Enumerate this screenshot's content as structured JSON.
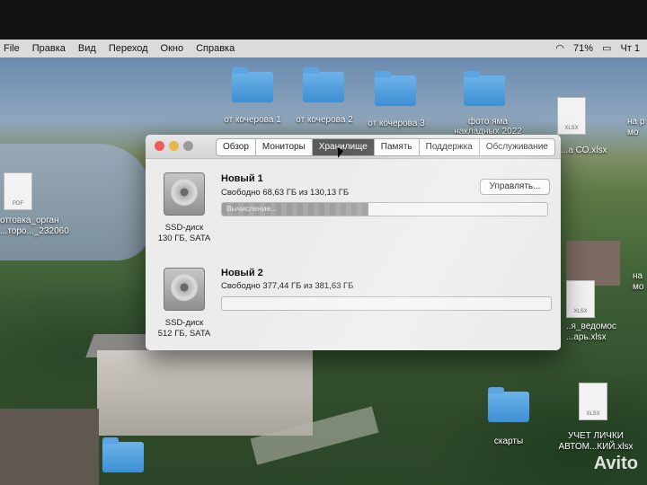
{
  "menubar": {
    "items": [
      "File",
      "Правка",
      "Вид",
      "Переход",
      "Окно",
      "Справка"
    ],
    "battery": "71%",
    "clock": "Чт 1"
  },
  "desktop": {
    "folders": [
      {
        "label": "от кочерова 1"
      },
      {
        "label": "от кочерова 2"
      },
      {
        "label": "от кочерова 3"
      },
      {
        "label": "фото яма\nнакладных 2022"
      },
      {
        "label": "скарты"
      }
    ],
    "files": [
      {
        "label": "отговка_орган\n...торо..._232060",
        "type": "PDF"
      },
      {
        "label": "...а СО.xlsx",
        "type": "XLSX"
      },
      {
        "label": "..я_ведомос\n...арь.xlsx",
        "type": "XLSX"
      },
      {
        "label": "УЧЕТ ЛИЧКИ\nАВТОМ...КИЙ.xlsx",
        "type": "XLSX"
      }
    ],
    "right_labels": [
      "на р\nмо",
      "на\nмо"
    ],
    "watermark": "Avito"
  },
  "window": {
    "tabs": [
      {
        "label": "Обзор",
        "active": false
      },
      {
        "label": "Мониторы",
        "active": false
      },
      {
        "label": "Хранилище",
        "active": true
      },
      {
        "label": "Память",
        "active": false
      },
      {
        "label": "Поддержка",
        "active": false
      },
      {
        "label": "Обслуживание",
        "active": false
      }
    ],
    "disks": [
      {
        "name": "Новый 1",
        "free": "Свободно 68,63 ГБ из 130,13 ГБ",
        "kind": "SSD-диск",
        "size": "130 ГБ, SATA",
        "bar_text": "Вычисление...",
        "fill_fraction": 0.45
      },
      {
        "name": "Новый 2",
        "free": "Свободно 377,44 ГБ из 381,63 ГБ",
        "kind": "SSD-диск",
        "size": "512 ГБ, SATA",
        "bar_text": "",
        "fill_fraction": 0.0
      }
    ],
    "manage_label": "Управлять..."
  }
}
